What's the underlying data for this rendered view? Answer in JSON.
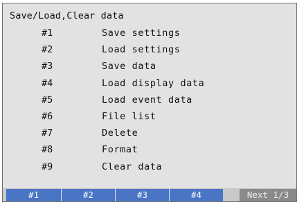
{
  "screen": {
    "title": "Save/Load,Clear data"
  },
  "menu": {
    "items": [
      {
        "num": "#1",
        "label": "Save settings"
      },
      {
        "num": "#2",
        "label": "Load settings"
      },
      {
        "num": "#3",
        "label": "Save data"
      },
      {
        "num": "#4",
        "label": "Load display data"
      },
      {
        "num": "#5",
        "label": "Load event data"
      },
      {
        "num": "#6",
        "label": "File list"
      },
      {
        "num": "#7",
        "label": "Delete"
      },
      {
        "num": "#8",
        "label": "Format"
      },
      {
        "num": "#9",
        "label": "Clear data"
      }
    ]
  },
  "softkeys": {
    "keys": [
      {
        "label": "#1"
      },
      {
        "label": "#2"
      },
      {
        "label": "#3"
      },
      {
        "label": "#4"
      }
    ],
    "next_label": "Next 1/3"
  },
  "colors": {
    "background": "#e2e2e2",
    "softkey_active": "#4a74c4",
    "softkey_next": "#8a8a8a",
    "text": "#111111"
  }
}
